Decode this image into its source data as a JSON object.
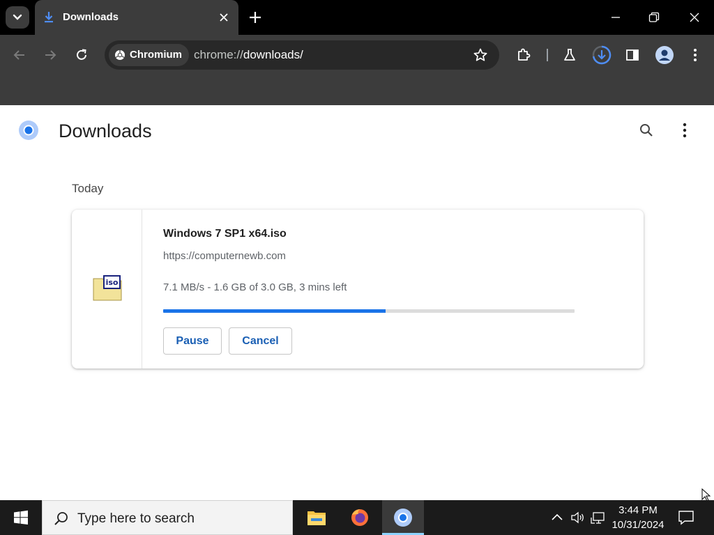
{
  "browser": {
    "tab": {
      "title": "Downloads",
      "favicon": "download-icon"
    },
    "omnibox": {
      "chip": "Chromium",
      "url_scheme": "chrome://",
      "url_host": "downloads",
      "url_path": "/"
    }
  },
  "page": {
    "title": "Downloads",
    "section_date": "Today",
    "download": {
      "file_name": "Windows 7 SP1 x64.iso",
      "source_url": "https://computernewb.com",
      "status": "7.1 MB/s - 1.6 GB of 3.0 GB, 3 mins left",
      "progress_fraction": 0.54,
      "file_icon_label": "iso",
      "pause_label": "Pause",
      "cancel_label": "Cancel"
    }
  },
  "taskbar": {
    "search_placeholder": "Type here to search",
    "time": "3:44 PM",
    "date": "10/31/2024",
    "pinned_apps": [
      "file-explorer",
      "firefox",
      "chromium"
    ]
  },
  "colors": {
    "accent": "#1a73e8",
    "button_text": "#1a5fb4",
    "chrome_dark": "#3c3c3c",
    "taskbar": "#1b1b1b"
  }
}
